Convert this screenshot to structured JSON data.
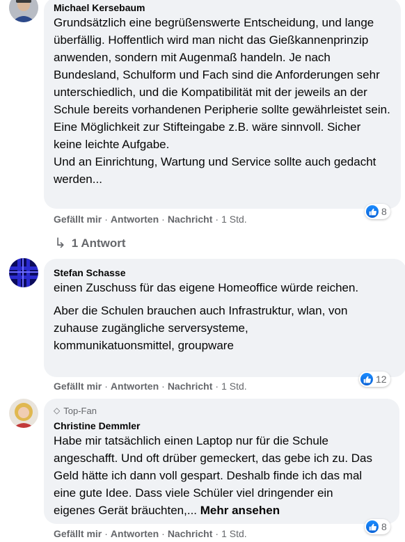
{
  "comments": [
    {
      "author": "Michael Kersebaum",
      "lines": [
        "Grundsätzlich eine begrüßenswerte Entscheidung, und lange überfällig. Hoffentlich wird man nicht das Gießkannenprinzip anwenden, sondern mit Augenmaß handeln. Je nach Bundesland, Schulform und Fach sind die Anforderungen sehr unterschiedlich, und die Kompatibilität mit der jeweils an der Schule bereits vorhandenen Peripherie sollte gewährleistet sein. Eine Möglichkeit zur Stifteingabe z.B. wäre sinnvoll. Sicher keine leichte Aufgabe.",
        "Und an Einrichtung, Wartung und Service sollte auch gedacht werden..."
      ],
      "like_label": "Gefällt mir",
      "reply_label": "Antworten",
      "message_label": "Nachricht",
      "time": "1 Std.",
      "reactions": "8",
      "replies": "1 Antwort"
    },
    {
      "author": "Stefan Schasse",
      "lines": [
        "einen Zuschuss für das eigene Homeoffice würde reichen.",
        "Aber die Schulen brauchen auch Infrastruktur, wlan, von zuhause zugängliche serversysteme, kommunikatuonsmittel, groupware"
      ],
      "like_label": "Gefällt mir",
      "reply_label": "Antworten",
      "message_label": "Nachricht",
      "time": "1 Std.",
      "reactions": "12"
    },
    {
      "badge": "Top-Fan",
      "author": "Christine Demmler",
      "lines": [
        "Habe mir tatsächlich einen Laptop nur für die Schule angeschafft. Und oft drüber gemeckert, das gebe ich zu. Das Geld hätte ich dann voll gespart. Deshalb finde ich das mal eine gute Idee. Dass viele Schüler viel dringender ein eigenes Gerät bräuchten,..."
      ],
      "more_label": "Mehr ansehen",
      "like_label": "Gefällt mir",
      "reply_label": "Antworten",
      "message_label": "Nachricht",
      "time": "1 Std.",
      "reactions": "8"
    }
  ],
  "colors": {
    "bubble": "#f0f2f5",
    "meta": "#65676b",
    "like": "#1877f2"
  }
}
